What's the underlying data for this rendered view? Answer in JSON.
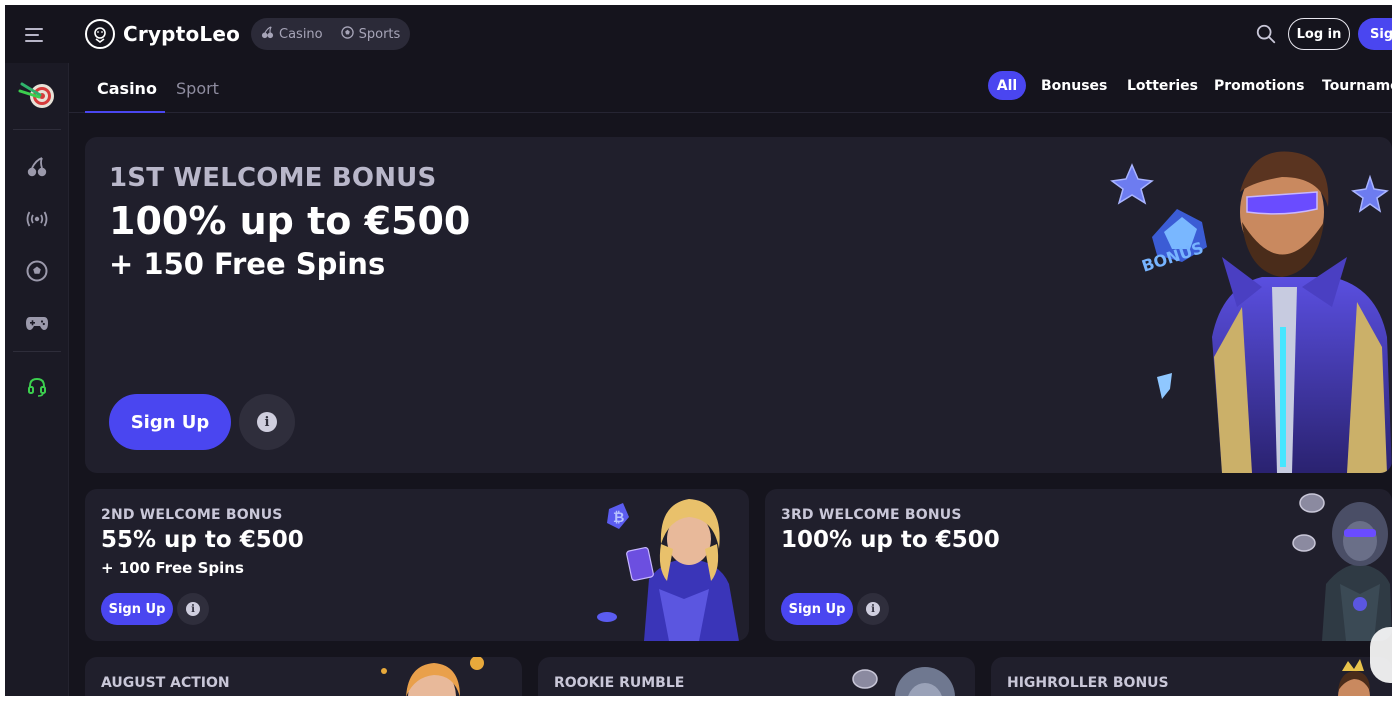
{
  "header": {
    "brand": "CryptoLeo",
    "modes": [
      {
        "label": "Casino",
        "icon": "cherry-icon"
      },
      {
        "label": "Sports",
        "icon": "soccer-ball-icon"
      }
    ],
    "login_label": "Log in",
    "signup_label": "Sign up"
  },
  "sidebar": {
    "items": [
      {
        "name": "darts-target-icon"
      },
      {
        "name": "cherry-icon"
      },
      {
        "name": "live-broadcast-icon"
      },
      {
        "name": "soccer-ball-icon"
      },
      {
        "name": "gamepad-icon"
      },
      {
        "name": "headset-support-icon"
      }
    ]
  },
  "subnav": {
    "tabs": [
      {
        "label": "Casino",
        "active": true
      },
      {
        "label": "Sport",
        "active": false
      }
    ],
    "filters": [
      {
        "label": "All",
        "active": true
      },
      {
        "label": "Bonuses"
      },
      {
        "label": "Lotteries"
      },
      {
        "label": "Promotions"
      },
      {
        "label": "Tournaments"
      }
    ]
  },
  "hero": {
    "eyebrow": "1ST WELCOME BONUS",
    "title": "100% up to €500",
    "subtitle": "+ 150 Free Spins",
    "cta": "Sign Up",
    "art_text": "BONUS"
  },
  "cards": [
    {
      "eyebrow": "2ND WELCOME BONUS",
      "title": "55% up to €500",
      "subtitle": "+ 100 Free Spins",
      "cta": "Sign Up"
    },
    {
      "eyebrow": "3RD WELCOME BONUS",
      "title": "100% up to €500",
      "subtitle": "",
      "cta": "Sign Up"
    }
  ],
  "promos": [
    {
      "label": "AUGUST ACTION"
    },
    {
      "label": "ROOKIE RUMBLE"
    },
    {
      "label": "HIGHROLLER BONUS"
    }
  ],
  "colors": {
    "accent": "#4a46f0",
    "background": "#15141d",
    "card": "#201f2c",
    "support_icon": "#3ccf4e"
  }
}
